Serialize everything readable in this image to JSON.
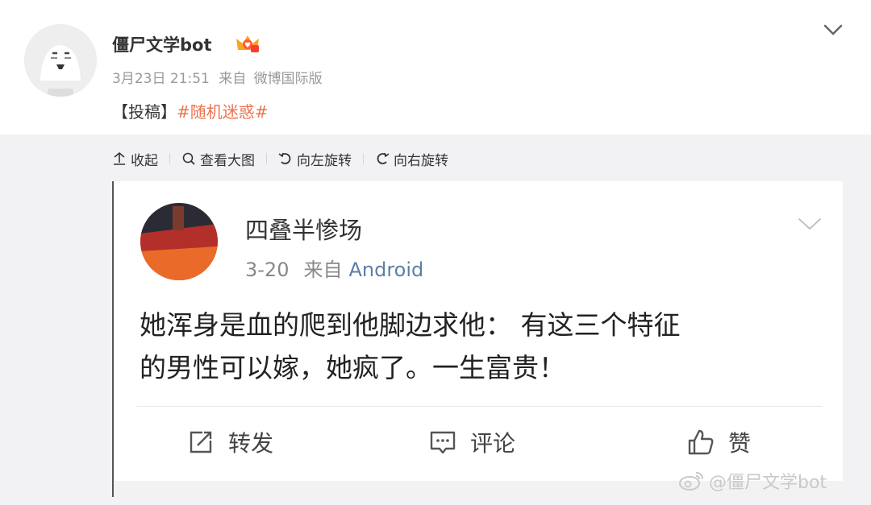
{
  "post": {
    "user_name": "僵尸文学bot",
    "date": "3月23日 21:51",
    "source_prefix": "来自",
    "source": "微博国际版",
    "text_prefix": "【投稿】",
    "topic": "#随机迷惑#"
  },
  "toolbar": {
    "collapse": "收起",
    "view_large": "查看大图",
    "rotate_left": "向左旋转",
    "rotate_right": "向右旋转"
  },
  "inner": {
    "user_name": "四叠半惨场",
    "date": "3-20",
    "source_prefix": "来自",
    "source": "Android",
    "text_line1": "她浑身是血的爬到他脚边求他： 有这三个特征",
    "text_line2": "的男性可以嫁，她疯了。一生富贵！",
    "repost": "转发",
    "comment": "评论",
    "like": "赞"
  },
  "watermark": "@僵尸文学bot",
  "colors": {
    "topic": "#eb7350",
    "source_link": "#5b7fa6",
    "media_bg": "#f2f2f5"
  },
  "icons": [
    "chevron-down-icon",
    "collapse-icon",
    "search-icon",
    "rotate-left-icon",
    "rotate-right-icon",
    "repost-icon",
    "comment-icon",
    "like-icon",
    "weibo-logo-icon",
    "vip-crown-icon"
  ]
}
